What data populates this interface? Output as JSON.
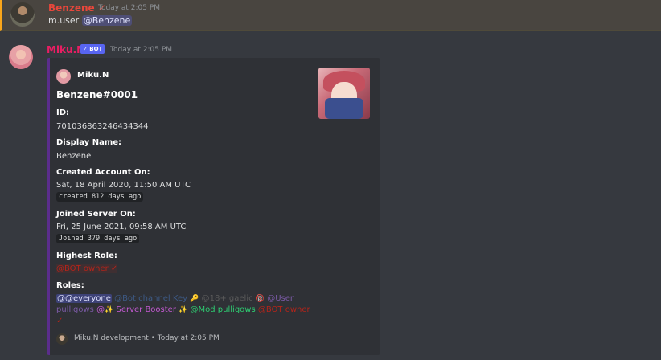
{
  "message1": {
    "username": "Benzene",
    "check": "✓",
    "time": "Today at 2:05 PM",
    "text": "m.user",
    "mention": "@Benzene"
  },
  "message2": {
    "username": "Miku.N",
    "bot_badge": "✓ BOT",
    "time": "Today at 2:05 PM",
    "embed": {
      "author": "Miku.N",
      "title": "Benzene#0001",
      "fields": {
        "id_label": "ID:",
        "id_value": "701036863246434344",
        "display_label": "Display Name:",
        "display_value": "Benzene",
        "created_label": "Created Account On:",
        "created_value": "Sat, 18 April 2020, 11:50 AM UTC",
        "created_ago": "created 812 days ago",
        "joined_label": "Joined Server On:",
        "joined_value": "Fri, 25 June 2021, 09:58 AM UTC",
        "joined_ago": "Joined 379 days ago",
        "highest_label": "Highest Role:",
        "highest_value": "@BOT owner ✓",
        "roles_label": "Roles:"
      },
      "roles": {
        "everyone": "@@everyone",
        "bot_channel_key": "@Bot channel Key",
        "key_emoji": "🔑",
        "hidden_role": "@18+ gaelic",
        "no_emoji": "🔞",
        "user": "@User",
        "pulligows": "pulligows",
        "at": "@",
        "sparkle": "✨",
        "booster": "Server Booster",
        "mod": "@Mod pulligows",
        "owner": "@BOT owner",
        "owner_check": "✓"
      },
      "footer": "Miku.N development • Today at 2:05 PM"
    }
  },
  "colors": {
    "background": "#36393f",
    "highlight": "#494540",
    "embed_bar": "#5b2d8c",
    "benzene_name": "#e8473b",
    "miku_name": "#e91e63",
    "bot_badge": "#5865f2"
  }
}
